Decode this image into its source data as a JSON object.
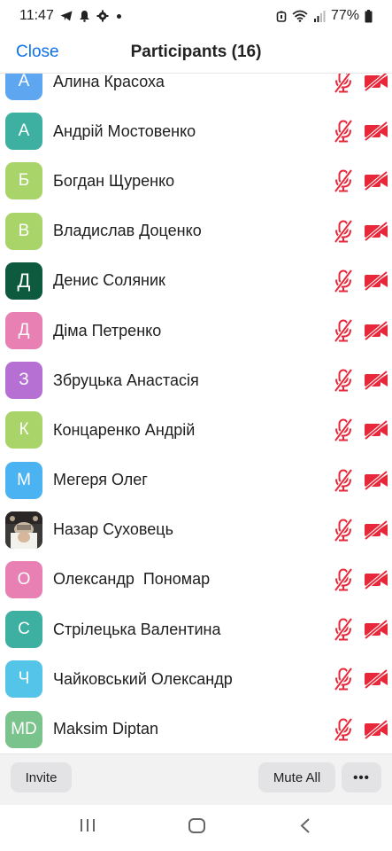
{
  "status_bar": {
    "time": "11:47",
    "left_icons": [
      "telegram-icon",
      "notification-icon",
      "gear-icon",
      "dot-icon"
    ],
    "battery": "77%",
    "right_icons": [
      "alarm-icon",
      "wifi-icon",
      "signal-icon",
      "battery-icon"
    ]
  },
  "header": {
    "close_label": "Close",
    "title": "Participants (16)"
  },
  "colors": {
    "accent": "#0e71eb",
    "muted_icon": "#e8283a"
  },
  "participants": [
    {
      "initial": "А",
      "name": "Алина Красоха",
      "avatar_color": "#5fa6f0",
      "mic": "muted",
      "video": "off"
    },
    {
      "initial": "А",
      "name": "Андрій Мостовенко",
      "avatar_color": "#3db0a2",
      "mic": "muted",
      "video": "off"
    },
    {
      "initial": "Б",
      "name": "Богдан Щуренко",
      "avatar_color": "#a9d46a",
      "mic": "muted",
      "video": "off"
    },
    {
      "initial": "В",
      "name": "Владислав Доценко",
      "avatar_color": "#a9d46a",
      "mic": "muted",
      "video": "off"
    },
    {
      "initial": "Д",
      "name": "Денис Соляник",
      "avatar_color": "#0d5a3f",
      "mic": "muted",
      "video": "off"
    },
    {
      "initial": "Д",
      "name": "Діма Петренко",
      "avatar_color": "#e880b4",
      "mic": "muted",
      "video": "off"
    },
    {
      "initial": "З",
      "name": "Збруцька Анастасія",
      "avatar_color": "#b66fd3",
      "mic": "muted",
      "video": "off"
    },
    {
      "initial": "К",
      "name": "Концаренко Андрій",
      "avatar_color": "#a9d46a",
      "mic": "muted",
      "video": "off"
    },
    {
      "initial": "М",
      "name": "Мегеря Олег",
      "avatar_color": "#4bb3f2",
      "mic": "muted",
      "video": "off"
    },
    {
      "initial": "",
      "name": "Назар Суховець",
      "avatar_color": "#3c3a39",
      "mic": "muted",
      "video": "off"
    },
    {
      "initial": "О",
      "name": "Олександр  Пономар",
      "avatar_color": "#e880b4",
      "mic": "muted",
      "video": "off"
    },
    {
      "initial": "С",
      "name": "Стрілецька Валентина",
      "avatar_color": "#3db0a2",
      "mic": "muted",
      "video": "off"
    },
    {
      "initial": "Ч",
      "name": "Чайковський Олександр",
      "avatar_color": "#54c4e8",
      "mic": "muted",
      "video": "off"
    },
    {
      "initial": "MD",
      "name": "Maksim Diptan",
      "avatar_color": "#7ac38c",
      "mic": "muted",
      "video": "off"
    }
  ],
  "toolbar": {
    "invite_label": "Invite",
    "mute_all_label": "Mute All",
    "more_label": "•••"
  },
  "navbar": {
    "items": [
      "recent-apps-icon",
      "home-icon",
      "back-icon"
    ]
  }
}
